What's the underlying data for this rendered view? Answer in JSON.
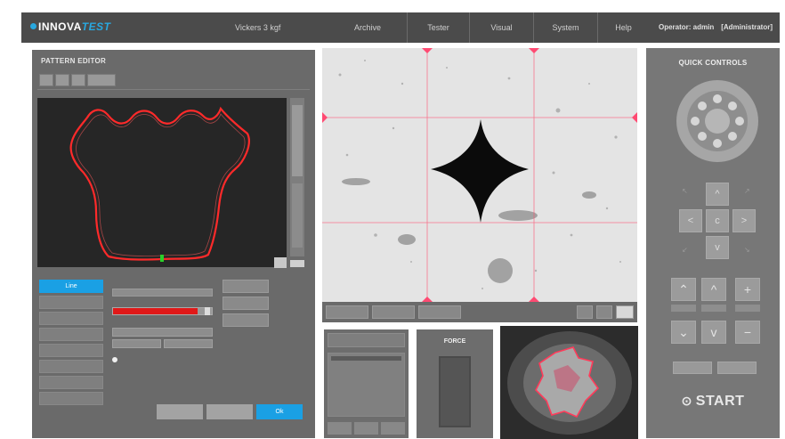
{
  "app": {
    "logo_prefix": "INNOVA",
    "logo_suffix": "TEST",
    "method": "Vickers 3 kgf"
  },
  "nav": {
    "items": [
      {
        "label": "Archive"
      },
      {
        "label": "Tester"
      },
      {
        "label": "Visual"
      },
      {
        "label": "System"
      },
      {
        "label": "Help"
      }
    ]
  },
  "operator": {
    "label": "Operator: admin",
    "role": "[Administrator]"
  },
  "pattern_editor": {
    "title": "PATTERN EDITOR",
    "selected_tool": "Line",
    "footer_ok": "Ok"
  },
  "force": {
    "title": "FORCE"
  },
  "quick_controls": {
    "title": "QUICK CONTROLS",
    "start_label": "START"
  },
  "colors": {
    "accent": "#1aa0e4",
    "outline": "#ff2a2a",
    "panel": "#6a6a6a",
    "topbar": "#4b4b4b"
  }
}
